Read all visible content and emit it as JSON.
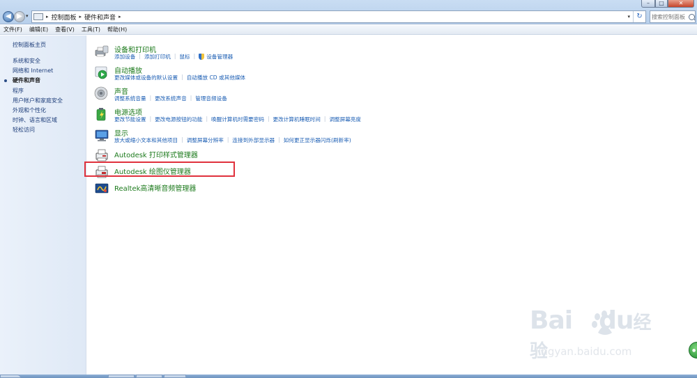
{
  "address_bar": {
    "crumbs": [
      "控制面板",
      "硬件和声音"
    ]
  },
  "search": {
    "placeholder": "搜索控制面板"
  },
  "menu": [
    "文件(F)",
    "编辑(E)",
    "查看(V)",
    "工具(T)",
    "帮助(H)"
  ],
  "sidebar": {
    "home": "控制面板主页",
    "items": [
      {
        "label": "系统和安全",
        "active": false
      },
      {
        "label": "网络和 Internet",
        "active": false
      },
      {
        "label": "硬件和声音",
        "active": true
      },
      {
        "label": "程序",
        "active": false
      },
      {
        "label": "用户帐户和家庭安全",
        "active": false
      },
      {
        "label": "外观和个性化",
        "active": false
      },
      {
        "label": "时钟、语言和区域",
        "active": false
      },
      {
        "label": "轻松访问",
        "active": false
      }
    ]
  },
  "groups": [
    {
      "title": "设备和打印机",
      "icon": "printer-icon",
      "links": [
        "添加设备",
        "添加打印机",
        "鼠标",
        "设备管理器"
      ]
    },
    {
      "title": "自动播放",
      "icon": "autoplay-icon",
      "links": [
        "更改媒体或设备的默认设置",
        "自动播放 CD 或其他媒体"
      ]
    },
    {
      "title": "声音",
      "icon": "speaker-icon",
      "links": [
        "调整系统音量",
        "更改系统声音",
        "管理音频设备"
      ]
    },
    {
      "title": "电源选项",
      "icon": "battery-icon",
      "links": [
        "更改节能设置",
        "更改电源按钮的功能",
        "唤醒计算机时需要密码",
        "更改计算机睡眠时间",
        "调整屏幕亮度"
      ]
    },
    {
      "title": "显示",
      "icon": "monitor-icon",
      "links": [
        "放大或缩小文本和其他项目",
        "调整屏幕分辨率",
        "连接到外部显示器",
        "如何更正显示器闪烁(刷新率)"
      ]
    }
  ],
  "singles": [
    {
      "title": "Autodesk 打印样式管理器",
      "icon": "autodesk-printer-icon"
    },
    {
      "title": "Autodesk 绘图仪管理器",
      "icon": "autodesk-plotter-icon"
    },
    {
      "title": "Realtek高清晰音频管理器",
      "icon": "realtek-icon"
    }
  ],
  "watermark": {
    "logo": "Bai",
    "logo2": "du",
    "logo3": "经验",
    "url": "jingyan.baidu.com"
  },
  "colors": {
    "title_green": "#1c7a1c",
    "link_blue": "#1d5fb4",
    "highlight_red": "#e0313c"
  }
}
